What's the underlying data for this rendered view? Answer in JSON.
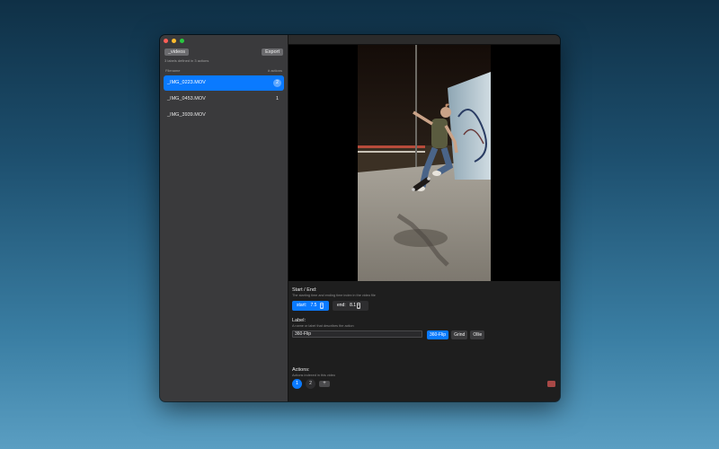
{
  "sidebar": {
    "videos_button": "_videos",
    "export_button": "Export",
    "subtitle": "3 labels defined in 3 actions",
    "col_left": "Filename",
    "col_right": "# actions",
    "files": [
      {
        "name": "_IMG_0223.MOV",
        "count": "2"
      },
      {
        "name": "_IMG_0453.MOV",
        "count": "1"
      },
      {
        "name": "_IMG_3939.MOV",
        "count": ""
      }
    ]
  },
  "start_end": {
    "title": "Start / End:",
    "desc": "The starting time and ending time index in the video file",
    "start_label": "start:",
    "start_value": "7.5",
    "end_label": "end:",
    "end_value": "8.1"
  },
  "label": {
    "title": "Label:",
    "desc": "A name or label that describes the action",
    "value": "360-Flip",
    "suggestions": [
      "360-Flip",
      "Grind",
      "Ollie"
    ]
  },
  "actions": {
    "title": "Actions:",
    "desc": "Actions indexed in this video",
    "tabs": [
      "1",
      "2"
    ],
    "add": "+"
  },
  "colors": {
    "accent": "#0a7aff",
    "delete": "#c0504d"
  }
}
